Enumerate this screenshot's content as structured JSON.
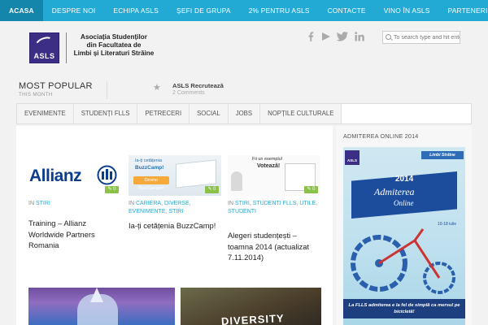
{
  "topnav": {
    "items": [
      "ACASA",
      "DESPRE NOI",
      "ECHIPA ASLS",
      "ȘEFI DE GRUPA",
      "2% PENTRU ASLS",
      "CONTACTE",
      "VINO ÎN ASLS",
      "PARTENERI ASLS"
    ]
  },
  "header": {
    "logo_abbr": "ASLS",
    "org_line1": "Asociația Studenților",
    "org_line2": "din Facultatea de",
    "org_line3": "Limbi și Literaturi Străine",
    "search_placeholder": "To search type and hit ente",
    "social_icons": [
      "facebook-icon",
      "youtube-icon",
      "twitter-icon",
      "linkedin-icon"
    ]
  },
  "popular": {
    "title": "MOST POPULAR",
    "subtitle": "THIS MONTH",
    "post_title": "ASLS Recrutează",
    "post_comments": "2 Comments"
  },
  "catnav": {
    "items": [
      "EVENIMENTE",
      "STUDENȚI FLLS",
      "PETRECERI",
      "SOCIAL",
      "JOBS",
      "NOPȚILE CULTURALE"
    ]
  },
  "posts": [
    {
      "thumb_brand": "Allianz",
      "comments": "0",
      "in": "IN",
      "categories": [
        "STIRI"
      ],
      "title": "Training – Allianz Worldwide Partners Romania"
    },
    {
      "thumb_text1": "Ia-ți cetățenia",
      "thumb_text2": "BuzzCamp!",
      "thumb_text3": "Devino BuzzCamper!",
      "comments": "0",
      "in": "IN",
      "categories": [
        "CARIERA",
        "DIVERSE",
        "EVENIMENTE",
        "STIRI"
      ],
      "title": "Ia-ți cetățenia BuzzCamp!"
    },
    {
      "thumb_text1": "Fii un exemplu!",
      "thumb_text2": "Votează!",
      "comments": "0",
      "in": "IN",
      "categories": [
        "STIRI",
        "STUDENTI FLLS",
        "UTILE",
        "STUDENTI"
      ],
      "title": "Alegeri studențești – toamna 2014 (actualizat 7.11.2014)"
    }
  ],
  "bottom": {
    "img2_text": "DIVERSITY"
  },
  "sidebar": {
    "title": "ADMITEREA ONLINE 2014",
    "ad_logo": "ASLS",
    "ad_brand": "Limbi Străine",
    "ad_year": "2014",
    "ad_word1": "Admiterea",
    "ad_word2": "Online",
    "ad_dates": "10-18 iulie",
    "ad_slogan": "La FLLS admiterea e la fel de simplă ca mersul pe bicicletă!"
  },
  "colors": {
    "nav_bg": "#22a9d4",
    "nav_active": "#1586ab",
    "accent_link": "#22a9d4",
    "badge_green": "#8bc04a"
  }
}
